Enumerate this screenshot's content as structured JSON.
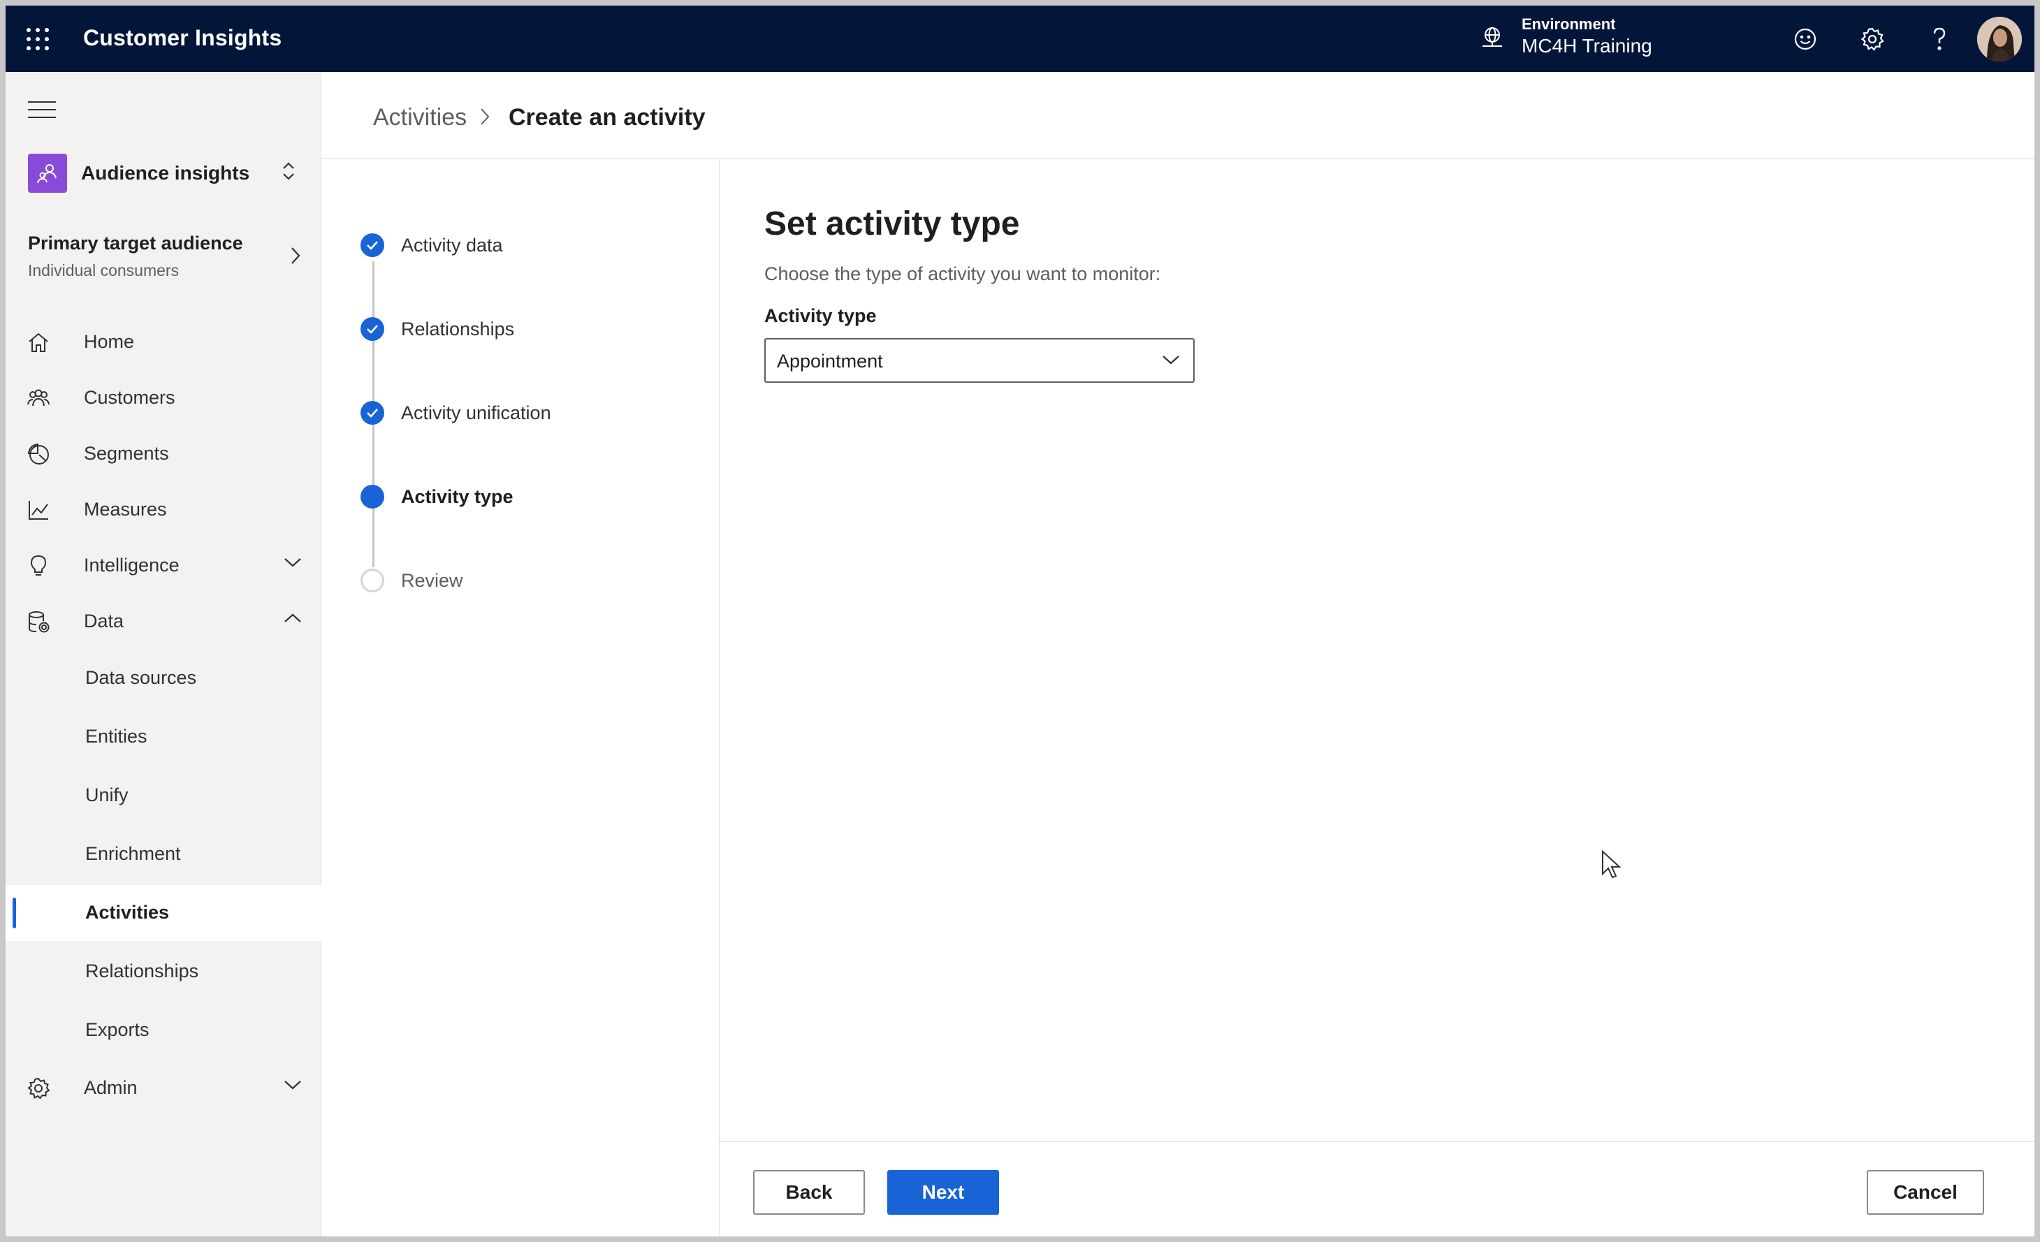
{
  "topbar": {
    "app_title": "Customer Insights",
    "environment_label": "Environment",
    "environment_name": "MC4H Training"
  },
  "sidebar": {
    "switcher_label": "Audience insights",
    "audience_title": "Primary target audience",
    "audience_subtitle": "Individual consumers",
    "items": [
      {
        "label": "Home",
        "icon": "home-icon"
      },
      {
        "label": "Customers",
        "icon": "customers-icon"
      },
      {
        "label": "Segments",
        "icon": "segments-icon"
      },
      {
        "label": "Measures",
        "icon": "measures-icon"
      },
      {
        "label": "Intelligence",
        "icon": "lightbulb-icon",
        "expanded": false
      },
      {
        "label": "Data",
        "icon": "database-icon",
        "expanded": true
      }
    ],
    "data_children": [
      {
        "label": "Data sources"
      },
      {
        "label": "Entities"
      },
      {
        "label": "Unify"
      },
      {
        "label": "Enrichment"
      },
      {
        "label": "Activities",
        "active": true
      },
      {
        "label": "Relationships"
      },
      {
        "label": "Exports"
      }
    ],
    "admin": {
      "label": "Admin",
      "icon": "gear-icon",
      "expanded": false
    }
  },
  "breadcrumb": {
    "parent": "Activities",
    "current": "Create an activity"
  },
  "steps": [
    {
      "label": "Activity data",
      "state": "done"
    },
    {
      "label": "Relationships",
      "state": "done"
    },
    {
      "label": "Activity unification",
      "state": "done"
    },
    {
      "label": "Activity type",
      "state": "current"
    },
    {
      "label": "Review",
      "state": "todo"
    }
  ],
  "form": {
    "heading": "Set activity type",
    "description": "Choose the type of activity you want to monitor:",
    "field_label": "Activity type",
    "field_value": "Appointment"
  },
  "footer": {
    "back_label": "Back",
    "next_label": "Next",
    "cancel_label": "Cancel"
  },
  "colors": {
    "topbar": "#03163a",
    "accent": "#1863d6",
    "sidebar_bg": "#f3f2f1",
    "switcher_badge": "#8a4ad8"
  }
}
